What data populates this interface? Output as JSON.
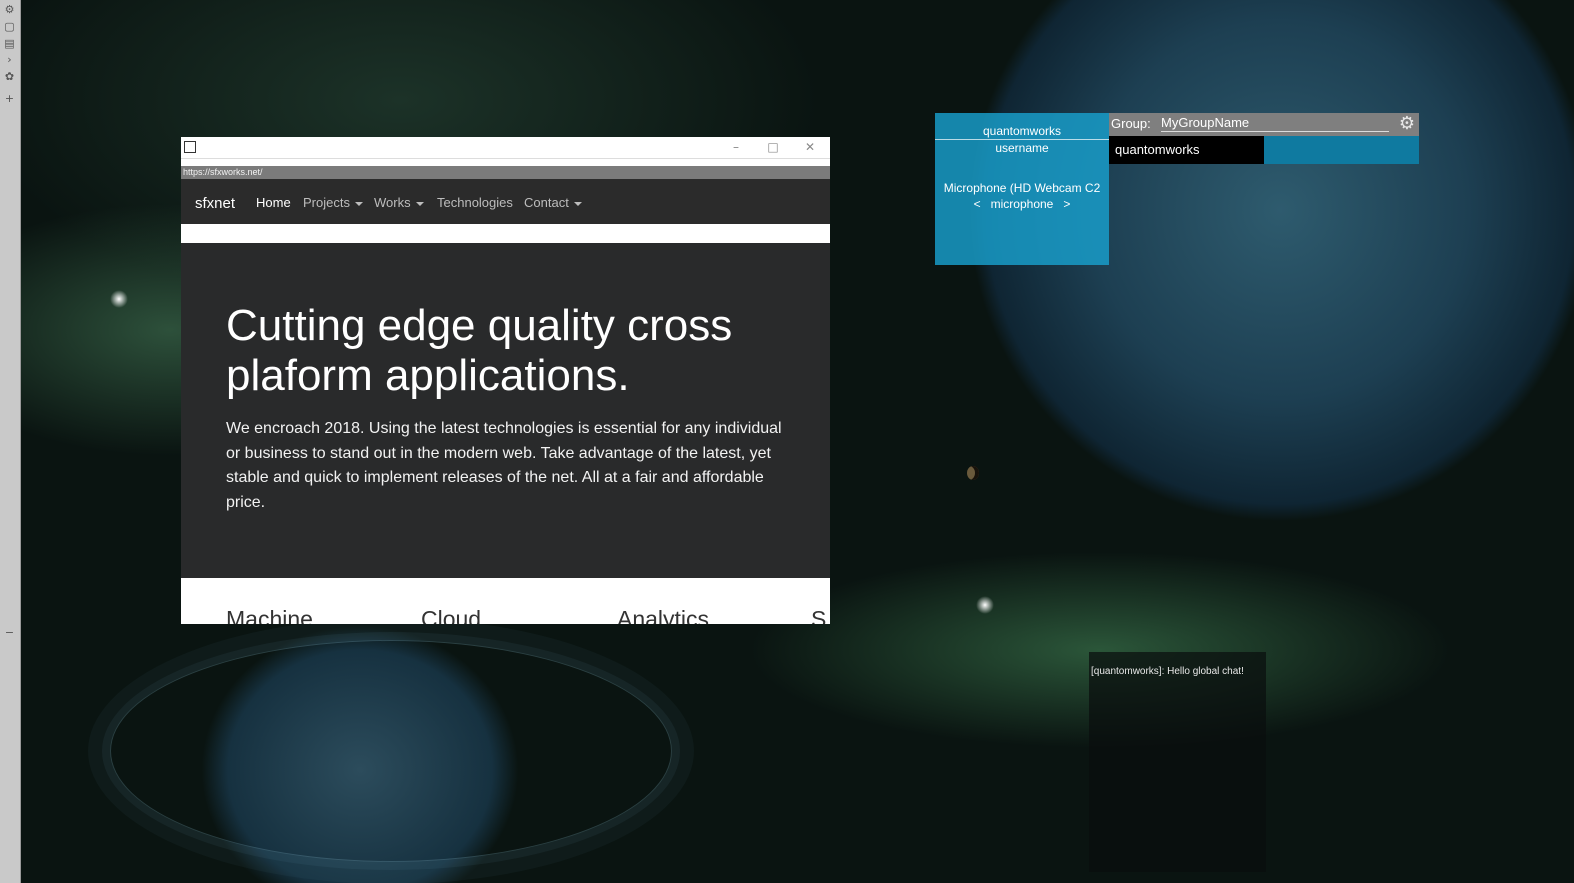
{
  "browser": {
    "url": "https://sfxworks.net/",
    "window_controls": {
      "minimize": "–",
      "maximize": "□",
      "close": "✕"
    },
    "navbar": {
      "brand": "sfxnet",
      "items": [
        {
          "label": "Home",
          "dropdown": false
        },
        {
          "label": "Projects",
          "dropdown": true
        },
        {
          "label": "Works",
          "dropdown": true
        },
        {
          "label": "Technologies",
          "dropdown": false
        },
        {
          "label": "Contact",
          "dropdown": true
        }
      ]
    },
    "hero": {
      "heading": "Cutting edge quality cross plaform applications.",
      "body": "We encroach 2018. Using the latest technologies is essential for any individual or business to stand out in the modern web. Take advantage of the latest, yet stable and quick to implement releases of the net. All at a fair and affordable price."
    },
    "features": [
      "Machine",
      "Cloud",
      "Analytics",
      "S"
    ]
  },
  "voice_panel": {
    "display_name": "quantomworks",
    "username_label": "username",
    "device": "Microphone (HD Webcam C2",
    "device_nav_prev": "<",
    "device_type": "microphone",
    "device_nav_next": ">"
  },
  "group": {
    "label": "Group:",
    "name": "MyGroupName",
    "gear_icon": "gear-icon",
    "members": [
      "quantomworks"
    ]
  },
  "chat": {
    "messages": [
      "[quantomworks]: Hello global chat!"
    ]
  },
  "colors": {
    "panel_blue": "#19a0cd",
    "member_bar": "#0f7aa0",
    "hero_bg": "#292a2b",
    "navbar_bg": "#2b2b2b"
  }
}
